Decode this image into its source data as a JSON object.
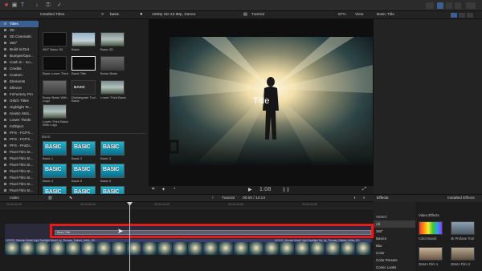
{
  "toolbar": {
    "icons": [
      "library-icon",
      "photos-icon",
      "titles-icon",
      "key-icon",
      "check-icon"
    ]
  },
  "browser": {
    "title": "Installed Titles",
    "search_value": "basic",
    "categories": [
      {
        "label": "Titles",
        "selected": true
      },
      {
        "label": "3D"
      },
      {
        "label": "3D Cinematic"
      },
      {
        "label": "360°"
      },
      {
        "label": "Build In/Out"
      },
      {
        "label": "Bumper/Ope..."
      },
      {
        "label": "Cash in - Ico..."
      },
      {
        "label": "Credits"
      },
      {
        "label": "Custom"
      },
      {
        "label": "Elements"
      },
      {
        "label": "Ellevon"
      },
      {
        "label": "FxFactory Pro"
      },
      {
        "label": "Glitch Titles"
      },
      {
        "label": "Highlight Te..."
      },
      {
        "label": "Kinetic Moti..."
      },
      {
        "label": "Lower Thirds"
      },
      {
        "label": "mObject"
      },
      {
        "label": "PFS - FCPX..."
      },
      {
        "label": "PFS - FCPX..."
      },
      {
        "label": "PFS - ProDr..."
      },
      {
        "label": "Pixel Film St..."
      },
      {
        "label": "Pixel Film St..."
      },
      {
        "label": "Pixel Film St..."
      },
      {
        "label": "Pixel Film St..."
      },
      {
        "label": "Pixel Film St..."
      },
      {
        "label": "Pixel Film St..."
      },
      {
        "label": "Pixel Film St..."
      }
    ],
    "thumbs": [
      {
        "label": "360° Basic 3D",
        "style": "dark"
      },
      {
        "label": "Basic",
        "style": "sky"
      },
      {
        "label": "Basic 3D",
        "style": "landscape"
      },
      {
        "label": "Basic Lower Third",
        "style": "dark"
      },
      {
        "label": "Basic Title",
        "style": "dark-sel"
      },
      {
        "label": "Bump Basic",
        "style": "gray"
      },
      {
        "label": "Bump Basic With Logo",
        "style": "gray"
      },
      {
        "label": "Disintegrate Tool - Basic",
        "style": "basic-text"
      },
      {
        "label": "Lower Third Basic",
        "style": "landscape"
      },
      {
        "label": "Lower Third Basic With Logo",
        "style": "landscape"
      }
    ],
    "section_label": "Basic",
    "basic_thumbs": [
      {
        "label": "Basic 1"
      },
      {
        "label": "Basic 2"
      },
      {
        "label": "Basic 3"
      },
      {
        "label": "Basic 4"
      },
      {
        "label": "Basic 5"
      },
      {
        "label": "Basic 6"
      },
      {
        "label": ""
      },
      {
        "label": ""
      },
      {
        "label": ""
      }
    ],
    "basic_word": "BASIC"
  },
  "viewer": {
    "format": "1080p HD 23.98p, Stereo",
    "project": "Tutorial",
    "zoom": "87%",
    "view_label": "View",
    "title_overlay": "Title",
    "timecode": "1:08"
  },
  "inspector": {
    "title": "Basic Title"
  },
  "timeline": {
    "index_label": "Index",
    "project_label": "Tutorial",
    "duration": "00:00 / 14:14",
    "title_clip": "Basic Title",
    "clip1": "470021_Woman Model Light Spotlight Model_by_Thomas_Dallant_Artlist_HD",
    "clip2": "470021_Woman Model Light Spotlight Mo_by_Thomas_Dallant_Artlist_HD",
    "ruler_marks": [
      "00:00:00:00",
      "00:00:05:00",
      "00:00:10:00",
      "00:00:15:00",
      "00:00:20:00",
      "00:00:25:00"
    ],
    "highlight_color": "#e01e1e"
  },
  "effects": {
    "header": "Effects",
    "installed_label": "Installed Effects",
    "categories": [
      {
        "label": "VIDEO"
      },
      {
        "label": "All",
        "selected": true
      },
      {
        "label": "360°"
      },
      {
        "label": "Basics"
      },
      {
        "label": "Blur"
      },
      {
        "label": "Color"
      },
      {
        "label": "Color Presets"
      },
      {
        "label": "Comic Looks"
      }
    ],
    "section_label": "Video Effects",
    "items": [
      {
        "label": "Color Board"
      },
      {
        "label": "4k Profane Tool"
      },
      {
        "label": "35mm Film 1"
      },
      {
        "label": "35mm Film 2"
      }
    ]
  }
}
